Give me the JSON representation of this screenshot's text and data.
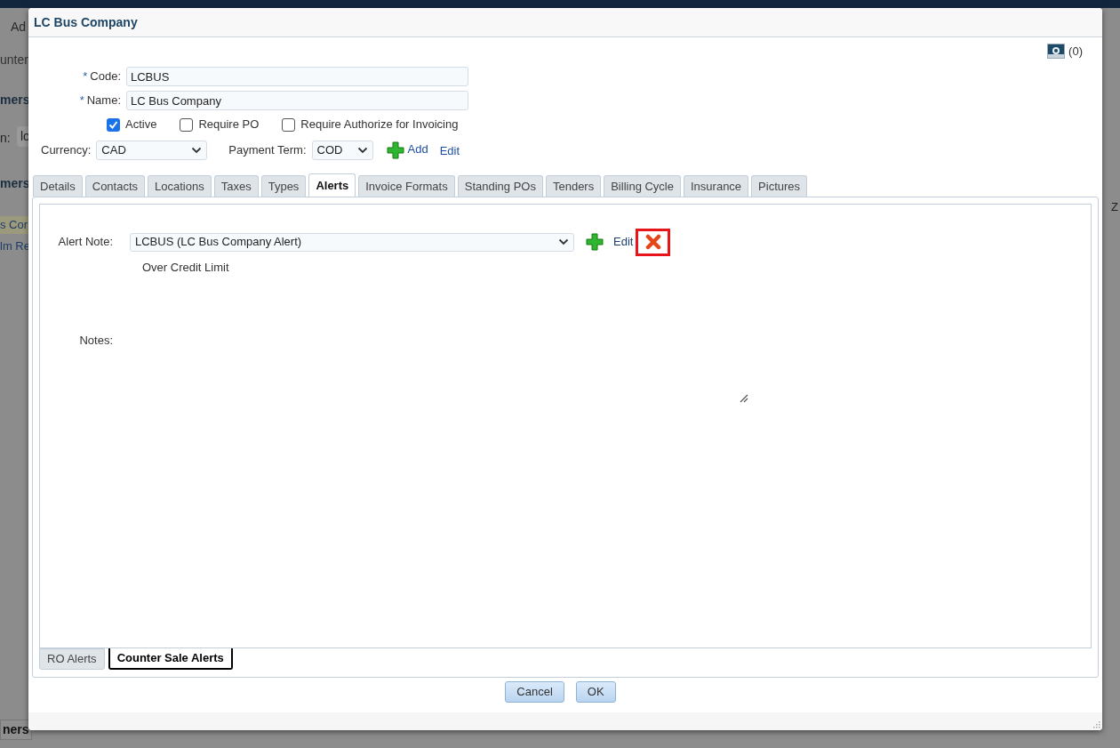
{
  "background": {
    "texts": [
      {
        "text": "Ad",
        "kind": "menu"
      },
      {
        "text": "unter",
        "kind": "tab"
      },
      {
        "text": "mers",
        "kind": "heading"
      },
      {
        "text": "n:",
        "kind": "label"
      },
      {
        "text": "lo",
        "kind": "field"
      },
      {
        "text": "mers",
        "kind": "heading"
      },
      {
        "text": "s Cor",
        "kind": "row"
      },
      {
        "text": "lm Re",
        "kind": "row"
      },
      {
        "text": "Z",
        "kind": "column"
      },
      {
        "text": "ners",
        "kind": "bottom-tab"
      }
    ]
  },
  "dialog": {
    "title": "LC Bus Company",
    "pictures_count": "(0)",
    "fields": [
      {
        "marker": "*",
        "label": "Code:",
        "value": "LCBUS"
      },
      {
        "marker": "*",
        "label": "Name:",
        "value": "LC Bus Company"
      }
    ],
    "checkboxes": [
      {
        "label": "Active",
        "checked": true
      },
      {
        "label": "Require PO",
        "checked": false
      },
      {
        "label": "Require Authorize for Invoicing",
        "checked": false
      }
    ],
    "currency": {
      "label": "Currency:",
      "value": "CAD"
    },
    "payment_term": {
      "label": "Payment Term:",
      "value": "COD",
      "add_link": "Add",
      "edit_link": "Edit"
    },
    "tabs": [
      {
        "label": "Details",
        "selected": false
      },
      {
        "label": "Contacts",
        "selected": false
      },
      {
        "label": "Locations",
        "selected": false
      },
      {
        "label": "Taxes",
        "selected": false
      },
      {
        "label": "Types",
        "selected": false
      },
      {
        "label": "Alerts",
        "selected": true
      },
      {
        "label": "Invoice Formats",
        "selected": false
      },
      {
        "label": "Standing POs",
        "selected": false
      },
      {
        "label": "Tenders",
        "selected": false
      },
      {
        "label": "Billing Cycle",
        "selected": false
      },
      {
        "label": "Insurance",
        "selected": false
      },
      {
        "label": "Pictures",
        "selected": false
      }
    ],
    "alerts": {
      "alert_note": {
        "label": "Alert Note:",
        "value": "LCBUS (LC Bus Company Alert)",
        "edit_link": "Edit"
      },
      "alert_text": "Over Credit Limit",
      "notes_label": "Notes:"
    },
    "sub_tabs": [
      {
        "label": "RO Alerts",
        "selected": false
      },
      {
        "label": "Counter Sale Alerts",
        "selected": true
      }
    ],
    "buttons": [
      "Cancel",
      "OK"
    ]
  }
}
